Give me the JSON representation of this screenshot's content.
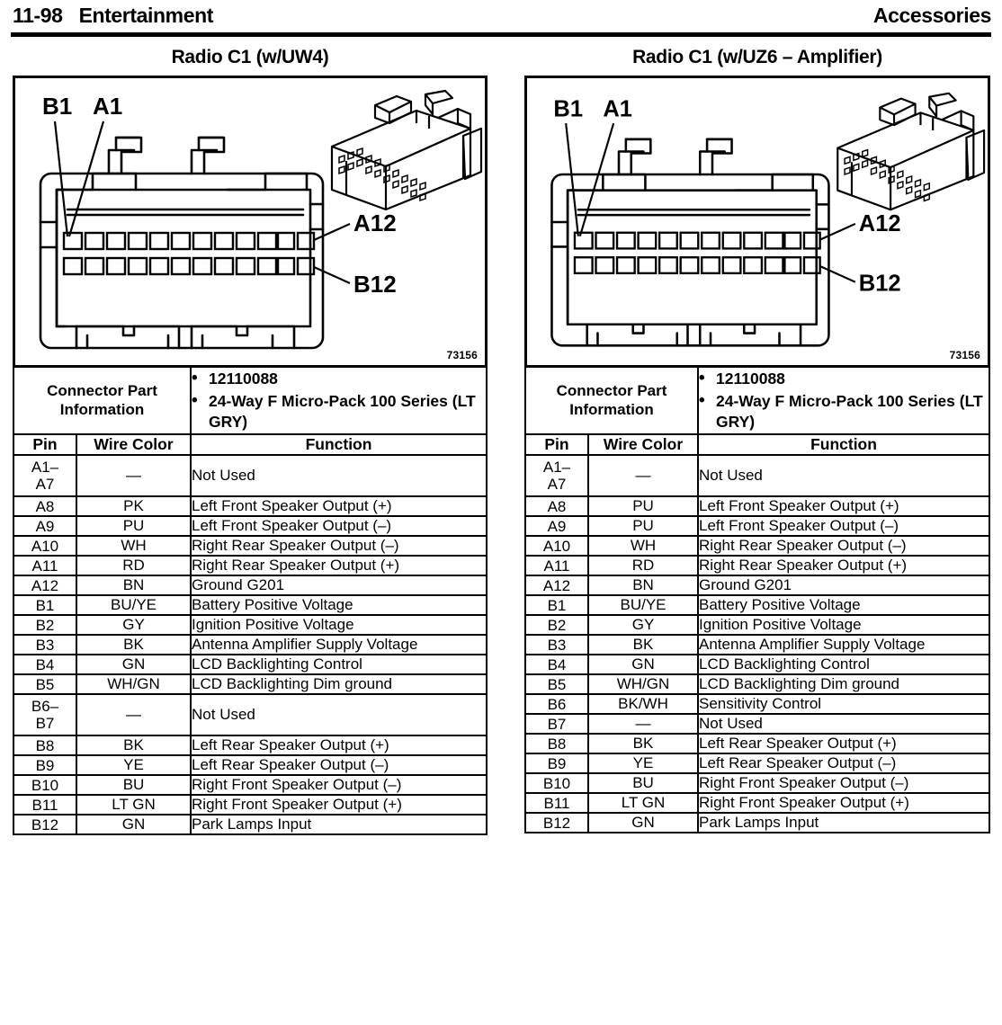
{
  "header": {
    "page_number": "11-98",
    "section": "Entertainment",
    "right_title": "Accessories"
  },
  "panels": [
    {
      "title": "Radio C1 (w/UW4)",
      "figure": {
        "callouts": {
          "top_left": "B1",
          "top_left2": "A1",
          "right_top": "A12",
          "right_bottom": "B12"
        },
        "figure_number": "73156",
        "pin_columns": 12,
        "pin_rows": 2
      },
      "connector_info": {
        "label": "Connector Part Information",
        "items": [
          "12110088",
          "24-Way F Micro-Pack 100 Series (LT GRY)"
        ]
      },
      "columns": [
        "Pin",
        "Wire Color",
        "Function"
      ],
      "rows": [
        {
          "pin": "A1–\nA7",
          "wire": "—",
          "function": "Not Used"
        },
        {
          "pin": "A8",
          "wire": "PK",
          "function": "Left Front Speaker Output (+)"
        },
        {
          "pin": "A9",
          "wire": "PU",
          "function": "Left Front Speaker Output (–)"
        },
        {
          "pin": "A10",
          "wire": "WH",
          "function": "Right Rear Speaker Output (–)"
        },
        {
          "pin": "A11",
          "wire": "RD",
          "function": "Right Rear Speaker Output (+)"
        },
        {
          "pin": "A12",
          "wire": "BN",
          "function": "Ground G201"
        },
        {
          "pin": "B1",
          "wire": "BU/YE",
          "function": "Battery Positive Voltage"
        },
        {
          "pin": "B2",
          "wire": "GY",
          "function": "Ignition Positive Voltage"
        },
        {
          "pin": "B3",
          "wire": "BK",
          "function": "Antenna Amplifier Supply Voltage"
        },
        {
          "pin": "B4",
          "wire": "GN",
          "function": "LCD Backlighting Control"
        },
        {
          "pin": "B5",
          "wire": "WH/GN",
          "function": "LCD Backlighting Dim ground"
        },
        {
          "pin": "B6–\nB7",
          "wire": "—",
          "function": "Not Used"
        },
        {
          "pin": "B8",
          "wire": "BK",
          "function": "Left Rear Speaker Output (+)"
        },
        {
          "pin": "B9",
          "wire": "YE",
          "function": "Left Rear Speaker Output (–)"
        },
        {
          "pin": "B10",
          "wire": "BU",
          "function": "Right Front Speaker Output (–)"
        },
        {
          "pin": "B11",
          "wire": "LT GN",
          "function": "Right Front Speaker Output (+)"
        },
        {
          "pin": "B12",
          "wire": "GN",
          "function": "Park Lamps Input"
        }
      ]
    },
    {
      "title": "Radio C1 (w/UZ6 – Amplifier)",
      "figure": {
        "callouts": {
          "top_left": "B1",
          "top_left2": "A1",
          "right_top": "A12",
          "right_bottom": "B12"
        },
        "figure_number": "73156",
        "pin_columns": 12,
        "pin_rows": 2
      },
      "connector_info": {
        "label": "Connector Part Information",
        "items": [
          "12110088",
          "24-Way F Micro-Pack 100 Series (LT GRY)"
        ]
      },
      "columns": [
        "Pin",
        "Wire Color",
        "Function"
      ],
      "rows": [
        {
          "pin": "A1–\nA7",
          "wire": "—",
          "function": "Not Used"
        },
        {
          "pin": "A8",
          "wire": "PU",
          "function": "Left Front Speaker Output (+)"
        },
        {
          "pin": "A9",
          "wire": "PU",
          "function": "Left Front Speaker Output (–)"
        },
        {
          "pin": "A10",
          "wire": "WH",
          "function": "Right Rear Speaker Output (–)"
        },
        {
          "pin": "A11",
          "wire": "RD",
          "function": "Right Rear Speaker Output (+)"
        },
        {
          "pin": "A12",
          "wire": "BN",
          "function": "Ground G201"
        },
        {
          "pin": "B1",
          "wire": "BU/YE",
          "function": "Battery Positive Voltage"
        },
        {
          "pin": "B2",
          "wire": "GY",
          "function": "Ignition Positive Voltage"
        },
        {
          "pin": "B3",
          "wire": "BK",
          "function": "Antenna Amplifier Supply Voltage"
        },
        {
          "pin": "B4",
          "wire": "GN",
          "function": "LCD Backlighting Control"
        },
        {
          "pin": "B5",
          "wire": "WH/GN",
          "function": "LCD Backlighting Dim ground"
        },
        {
          "pin": "B6",
          "wire": "BK/WH",
          "function": "Sensitivity Control"
        },
        {
          "pin": "B7",
          "wire": "—",
          "function": "Not Used"
        },
        {
          "pin": "B8",
          "wire": "BK",
          "function": "Left Rear Speaker Output (+)"
        },
        {
          "pin": "B9",
          "wire": "YE",
          "function": "Left Rear Speaker Output (–)"
        },
        {
          "pin": "B10",
          "wire": "BU",
          "function": "Right Front Speaker Output (–)"
        },
        {
          "pin": "B11",
          "wire": "LT GN",
          "function": "Right Front Speaker Output (+)"
        },
        {
          "pin": "B12",
          "wire": "GN",
          "function": "Park Lamps Input"
        }
      ]
    }
  ]
}
